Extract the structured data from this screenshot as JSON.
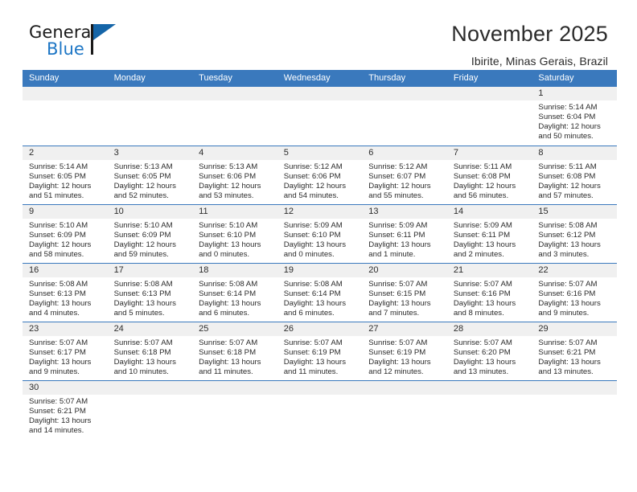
{
  "brand": {
    "name_top": "General",
    "name_bottom": "Blue",
    "accent_color": "#1d76c5",
    "flag_color": "#1565a8"
  },
  "header": {
    "title": "November 2025",
    "subtitle": "Ibirite, Minas Gerais, Brazil"
  },
  "theme": {
    "header_bg": "#3a79bd",
    "day_band_bg": "#f0f0f0",
    "text_color": "#2b2b2b"
  },
  "weekdays": [
    "Sunday",
    "Monday",
    "Tuesday",
    "Wednesday",
    "Thursday",
    "Friday",
    "Saturday"
  ],
  "weeks": [
    [
      {
        "day": "",
        "empty": true
      },
      {
        "day": "",
        "empty": true
      },
      {
        "day": "",
        "empty": true
      },
      {
        "day": "",
        "empty": true
      },
      {
        "day": "",
        "empty": true
      },
      {
        "day": "",
        "empty": true
      },
      {
        "day": "1",
        "sunrise": "Sunrise: 5:14 AM",
        "sunset": "Sunset: 6:04 PM",
        "daylight1": "Daylight: 12 hours",
        "daylight2": "and 50 minutes."
      }
    ],
    [
      {
        "day": "2",
        "sunrise": "Sunrise: 5:14 AM",
        "sunset": "Sunset: 6:05 PM",
        "daylight1": "Daylight: 12 hours",
        "daylight2": "and 51 minutes."
      },
      {
        "day": "3",
        "sunrise": "Sunrise: 5:13 AM",
        "sunset": "Sunset: 6:05 PM",
        "daylight1": "Daylight: 12 hours",
        "daylight2": "and 52 minutes."
      },
      {
        "day": "4",
        "sunrise": "Sunrise: 5:13 AM",
        "sunset": "Sunset: 6:06 PM",
        "daylight1": "Daylight: 12 hours",
        "daylight2": "and 53 minutes."
      },
      {
        "day": "5",
        "sunrise": "Sunrise: 5:12 AM",
        "sunset": "Sunset: 6:06 PM",
        "daylight1": "Daylight: 12 hours",
        "daylight2": "and 54 minutes."
      },
      {
        "day": "6",
        "sunrise": "Sunrise: 5:12 AM",
        "sunset": "Sunset: 6:07 PM",
        "daylight1": "Daylight: 12 hours",
        "daylight2": "and 55 minutes."
      },
      {
        "day": "7",
        "sunrise": "Sunrise: 5:11 AM",
        "sunset": "Sunset: 6:08 PM",
        "daylight1": "Daylight: 12 hours",
        "daylight2": "and 56 minutes."
      },
      {
        "day": "8",
        "sunrise": "Sunrise: 5:11 AM",
        "sunset": "Sunset: 6:08 PM",
        "daylight1": "Daylight: 12 hours",
        "daylight2": "and 57 minutes."
      }
    ],
    [
      {
        "day": "9",
        "sunrise": "Sunrise: 5:10 AM",
        "sunset": "Sunset: 6:09 PM",
        "daylight1": "Daylight: 12 hours",
        "daylight2": "and 58 minutes."
      },
      {
        "day": "10",
        "sunrise": "Sunrise: 5:10 AM",
        "sunset": "Sunset: 6:09 PM",
        "daylight1": "Daylight: 12 hours",
        "daylight2": "and 59 minutes."
      },
      {
        "day": "11",
        "sunrise": "Sunrise: 5:10 AM",
        "sunset": "Sunset: 6:10 PM",
        "daylight1": "Daylight: 13 hours",
        "daylight2": "and 0 minutes."
      },
      {
        "day": "12",
        "sunrise": "Sunrise: 5:09 AM",
        "sunset": "Sunset: 6:10 PM",
        "daylight1": "Daylight: 13 hours",
        "daylight2": "and 0 minutes."
      },
      {
        "day": "13",
        "sunrise": "Sunrise: 5:09 AM",
        "sunset": "Sunset: 6:11 PM",
        "daylight1": "Daylight: 13 hours",
        "daylight2": "and 1 minute."
      },
      {
        "day": "14",
        "sunrise": "Sunrise: 5:09 AM",
        "sunset": "Sunset: 6:11 PM",
        "daylight1": "Daylight: 13 hours",
        "daylight2": "and 2 minutes."
      },
      {
        "day": "15",
        "sunrise": "Sunrise: 5:08 AM",
        "sunset": "Sunset: 6:12 PM",
        "daylight1": "Daylight: 13 hours",
        "daylight2": "and 3 minutes."
      }
    ],
    [
      {
        "day": "16",
        "sunrise": "Sunrise: 5:08 AM",
        "sunset": "Sunset: 6:13 PM",
        "daylight1": "Daylight: 13 hours",
        "daylight2": "and 4 minutes."
      },
      {
        "day": "17",
        "sunrise": "Sunrise: 5:08 AM",
        "sunset": "Sunset: 6:13 PM",
        "daylight1": "Daylight: 13 hours",
        "daylight2": "and 5 minutes."
      },
      {
        "day": "18",
        "sunrise": "Sunrise: 5:08 AM",
        "sunset": "Sunset: 6:14 PM",
        "daylight1": "Daylight: 13 hours",
        "daylight2": "and 6 minutes."
      },
      {
        "day": "19",
        "sunrise": "Sunrise: 5:08 AM",
        "sunset": "Sunset: 6:14 PM",
        "daylight1": "Daylight: 13 hours",
        "daylight2": "and 6 minutes."
      },
      {
        "day": "20",
        "sunrise": "Sunrise: 5:07 AM",
        "sunset": "Sunset: 6:15 PM",
        "daylight1": "Daylight: 13 hours",
        "daylight2": "and 7 minutes."
      },
      {
        "day": "21",
        "sunrise": "Sunrise: 5:07 AM",
        "sunset": "Sunset: 6:16 PM",
        "daylight1": "Daylight: 13 hours",
        "daylight2": "and 8 minutes."
      },
      {
        "day": "22",
        "sunrise": "Sunrise: 5:07 AM",
        "sunset": "Sunset: 6:16 PM",
        "daylight1": "Daylight: 13 hours",
        "daylight2": "and 9 minutes."
      }
    ],
    [
      {
        "day": "23",
        "sunrise": "Sunrise: 5:07 AM",
        "sunset": "Sunset: 6:17 PM",
        "daylight1": "Daylight: 13 hours",
        "daylight2": "and 9 minutes."
      },
      {
        "day": "24",
        "sunrise": "Sunrise: 5:07 AM",
        "sunset": "Sunset: 6:18 PM",
        "daylight1": "Daylight: 13 hours",
        "daylight2": "and 10 minutes."
      },
      {
        "day": "25",
        "sunrise": "Sunrise: 5:07 AM",
        "sunset": "Sunset: 6:18 PM",
        "daylight1": "Daylight: 13 hours",
        "daylight2": "and 11 minutes."
      },
      {
        "day": "26",
        "sunrise": "Sunrise: 5:07 AM",
        "sunset": "Sunset: 6:19 PM",
        "daylight1": "Daylight: 13 hours",
        "daylight2": "and 11 minutes."
      },
      {
        "day": "27",
        "sunrise": "Sunrise: 5:07 AM",
        "sunset": "Sunset: 6:19 PM",
        "daylight1": "Daylight: 13 hours",
        "daylight2": "and 12 minutes."
      },
      {
        "day": "28",
        "sunrise": "Sunrise: 5:07 AM",
        "sunset": "Sunset: 6:20 PM",
        "daylight1": "Daylight: 13 hours",
        "daylight2": "and 13 minutes."
      },
      {
        "day": "29",
        "sunrise": "Sunrise: 5:07 AM",
        "sunset": "Sunset: 6:21 PM",
        "daylight1": "Daylight: 13 hours",
        "daylight2": "and 13 minutes."
      }
    ],
    [
      {
        "day": "30",
        "sunrise": "Sunrise: 5:07 AM",
        "sunset": "Sunset: 6:21 PM",
        "daylight1": "Daylight: 13 hours",
        "daylight2": "and 14 minutes."
      },
      {
        "day": "",
        "empty": true
      },
      {
        "day": "",
        "empty": true
      },
      {
        "day": "",
        "empty": true
      },
      {
        "day": "",
        "empty": true
      },
      {
        "day": "",
        "empty": true
      },
      {
        "day": "",
        "empty": true
      }
    ]
  ]
}
